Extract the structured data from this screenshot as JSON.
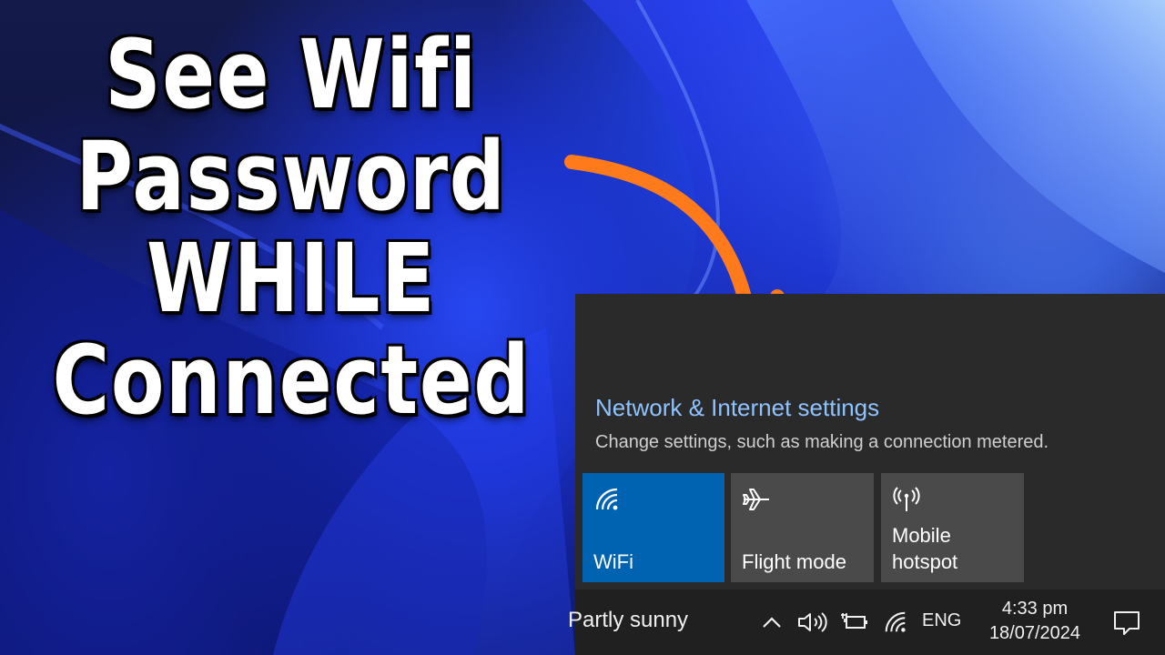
{
  "headline": {
    "line1": "See Wifi",
    "line2": "Password",
    "line3": "WHILE",
    "line4": "Connected"
  },
  "colors": {
    "arrow": "#ff7a1a",
    "accent_link": "#8fc3ff",
    "active_tile": "#0063b1",
    "panel": "#2a2a2a",
    "taskbar": "#202020"
  },
  "network_panel": {
    "title": "Network & Internet settings",
    "subtitle": "Change settings, such as making a connection metered.",
    "tiles": [
      {
        "icon": "wifi-icon",
        "label": "WiFi",
        "active": true
      },
      {
        "icon": "airplane-icon",
        "label": "Flight mode",
        "active": false
      },
      {
        "icon": "hotspot-icon",
        "label_line1": "Mobile",
        "label_line2": "hotspot",
        "active": false
      }
    ]
  },
  "taskbar": {
    "weather": "Partly sunny",
    "language": "ENG",
    "time": "4:33 pm",
    "date": "18/07/2024",
    "tray_icons": [
      "chevron-up-icon",
      "volume-icon",
      "battery-plug-icon",
      "wifi-icon",
      "notification-icon"
    ]
  }
}
